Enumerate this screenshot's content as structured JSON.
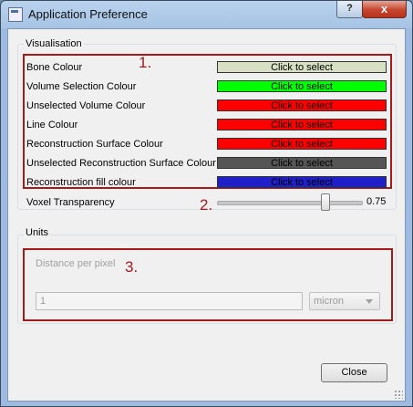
{
  "window": {
    "title": "Application Preference",
    "help": "?",
    "close": "x"
  },
  "visualisation": {
    "group_label": "Visualisation",
    "annotation": "1.",
    "rows": [
      {
        "label": "Bone Colour",
        "button": "Click to select",
        "color": "#d8e0c4"
      },
      {
        "label": "Volume Selection Colour",
        "button": "Click to select",
        "color": "#00ff00"
      },
      {
        "label": "Unselected Volume Colour",
        "button": "Click to select",
        "color": "#ff0000"
      },
      {
        "label": "Line Colour",
        "button": "Click to select",
        "color": "#ff0000"
      },
      {
        "label": "Reconstruction Surface Colour",
        "button": "Click to select",
        "color": "#ff0000"
      },
      {
        "label": "Unselected Reconstruction Surface Colour",
        "button": "Click to select",
        "color": "#555555"
      },
      {
        "label": "Reconstruction fill colour",
        "button": "Click to select",
        "color": "#2020c8"
      }
    ]
  },
  "voxel": {
    "label": "Voxel Transparency",
    "value": "0.75",
    "level": 0.75,
    "annotation": "2."
  },
  "units": {
    "group_label": "Units",
    "annotation": "3.",
    "distance_label": "Distance per pixel",
    "distance_value": "1",
    "unit": "micron"
  },
  "footer": {
    "close_label": "Close"
  }
}
